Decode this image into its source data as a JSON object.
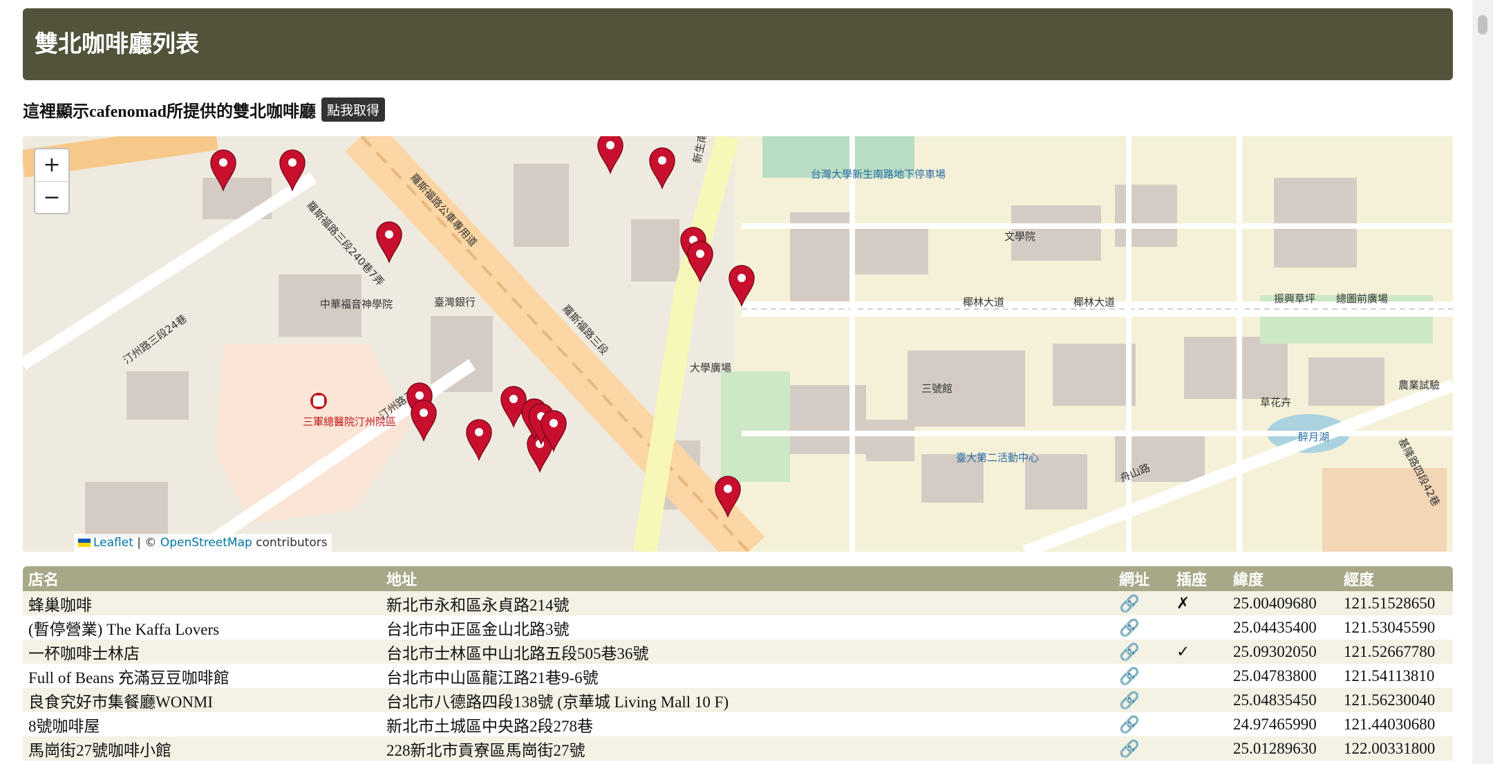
{
  "header": {
    "title": "雙北咖啡廳列表"
  },
  "intro": {
    "text": "這裡顯示cafenomad所提供的雙北咖啡廳",
    "button_label": "點我取得"
  },
  "map": {
    "zoom_in": "+",
    "zoom_out": "−",
    "attribution": {
      "leaflet": "Leaflet",
      "separator": "| ©",
      "osm": "OpenStreetMap",
      "suffix": "contributors"
    },
    "labels": {
      "road_keelung": "羅斯福路三段240巷7弄",
      "road_roosevelt_bus": "羅斯福路公車專用道",
      "road_roosevelt3": "羅斯福路三段",
      "road_xinsheng": "新生南路三段",
      "road_tingzhou": "汀州路三段",
      "road_tingzhou_24": "汀州路三段24巷",
      "road_coconut": "椰林大道",
      "road_zhoushan": "舟山路",
      "road_jilin": "基隆路四段42巷",
      "cn_church": "中華福音神學院",
      "hospital": "三軍總醫院汀州院區",
      "taiwan_bank": "臺灣銀行",
      "ntu_library": "總圖前廣場",
      "ntu_square": "大學廣場",
      "fu_garden": "振興草坪",
      "liberal_arts": "文學院",
      "sanhao": "三號館",
      "drunk_moon": "醉月湖",
      "zhangqiu": "臺大第二活動中心",
      "agri": "農業試驗",
      "grass": "草花卉",
      "xinsheng_bus": "台灣大學新生南路地下停車場"
    },
    "pins_count": 17
  },
  "table": {
    "headers": [
      "店名",
      "地址",
      "網址",
      "插座",
      "緯度",
      "經度"
    ],
    "rows": [
      {
        "name": "蜂巢咖啡",
        "address": "新北市永和區永貞路214號",
        "url_icon": "link-icon",
        "socket": "✗",
        "lat": "25.00409680",
        "lng": "121.51528650"
      },
      {
        "name": "(暫停營業) The Kaffa Lovers",
        "address": "台北市中正區金山北路3號",
        "url_icon": "link-icon",
        "socket": "",
        "lat": "25.04435400",
        "lng": "121.53045590"
      },
      {
        "name": "一杯咖啡士林店",
        "address": "台北市士林區中山北路五段505巷36號",
        "url_icon": "link-icon",
        "socket": "✓",
        "lat": "25.09302050",
        "lng": "121.52667780"
      },
      {
        "name": "Full of Beans 充滿豆豆咖啡館",
        "address": "台北市中山區龍江路21巷9-6號",
        "url_icon": "link-icon",
        "socket": "",
        "lat": "25.04783800",
        "lng": "121.54113810"
      },
      {
        "name": "良食究好市集餐廳WONMI",
        "address": "台北市八德路四段138號 (京華城 Living Mall 10 F)",
        "url_icon": "link-icon",
        "socket": "",
        "lat": "25.04835450",
        "lng": "121.56230040"
      },
      {
        "name": "8號咖啡屋",
        "address": "新北市土城區中央路2段278巷",
        "url_icon": "link-icon",
        "socket": "",
        "lat": "24.97465990",
        "lng": "121.44030680"
      },
      {
        "name": "馬崗街27號咖啡小館",
        "address": "228新北市貢寮區馬崗街27號",
        "url_icon": "link-icon",
        "socket": "",
        "lat": "25.01289630",
        "lng": "122.00331800"
      }
    ]
  }
}
